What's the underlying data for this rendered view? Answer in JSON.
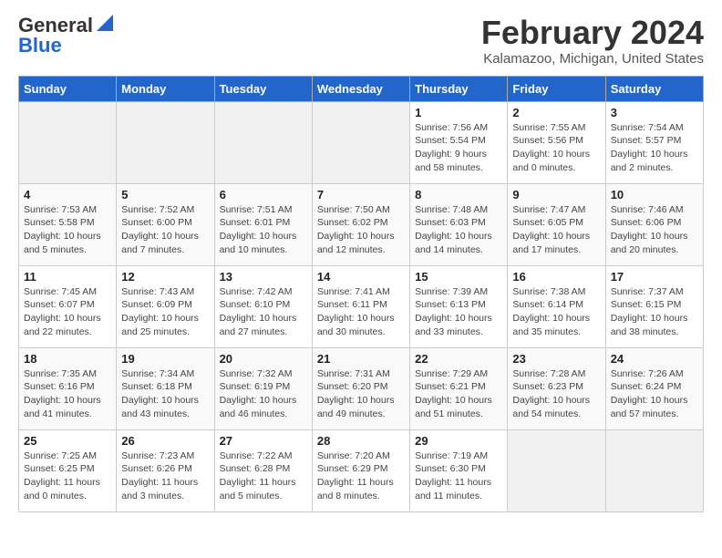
{
  "logo": {
    "general": "General",
    "blue": "Blue"
  },
  "title": {
    "month_year": "February 2024",
    "location": "Kalamazoo, Michigan, United States"
  },
  "headers": [
    "Sunday",
    "Monday",
    "Tuesday",
    "Wednesday",
    "Thursday",
    "Friday",
    "Saturday"
  ],
  "weeks": [
    [
      {
        "day": "",
        "info": ""
      },
      {
        "day": "",
        "info": ""
      },
      {
        "day": "",
        "info": ""
      },
      {
        "day": "",
        "info": ""
      },
      {
        "day": "1",
        "info": "Sunrise: 7:56 AM\nSunset: 5:54 PM\nDaylight: 9 hours\nand 58 minutes."
      },
      {
        "day": "2",
        "info": "Sunrise: 7:55 AM\nSunset: 5:56 PM\nDaylight: 10 hours\nand 0 minutes."
      },
      {
        "day": "3",
        "info": "Sunrise: 7:54 AM\nSunset: 5:57 PM\nDaylight: 10 hours\nand 2 minutes."
      }
    ],
    [
      {
        "day": "4",
        "info": "Sunrise: 7:53 AM\nSunset: 5:58 PM\nDaylight: 10 hours\nand 5 minutes."
      },
      {
        "day": "5",
        "info": "Sunrise: 7:52 AM\nSunset: 6:00 PM\nDaylight: 10 hours\nand 7 minutes."
      },
      {
        "day": "6",
        "info": "Sunrise: 7:51 AM\nSunset: 6:01 PM\nDaylight: 10 hours\nand 10 minutes."
      },
      {
        "day": "7",
        "info": "Sunrise: 7:50 AM\nSunset: 6:02 PM\nDaylight: 10 hours\nand 12 minutes."
      },
      {
        "day": "8",
        "info": "Sunrise: 7:48 AM\nSunset: 6:03 PM\nDaylight: 10 hours\nand 14 minutes."
      },
      {
        "day": "9",
        "info": "Sunrise: 7:47 AM\nSunset: 6:05 PM\nDaylight: 10 hours\nand 17 minutes."
      },
      {
        "day": "10",
        "info": "Sunrise: 7:46 AM\nSunset: 6:06 PM\nDaylight: 10 hours\nand 20 minutes."
      }
    ],
    [
      {
        "day": "11",
        "info": "Sunrise: 7:45 AM\nSunset: 6:07 PM\nDaylight: 10 hours\nand 22 minutes."
      },
      {
        "day": "12",
        "info": "Sunrise: 7:43 AM\nSunset: 6:09 PM\nDaylight: 10 hours\nand 25 minutes."
      },
      {
        "day": "13",
        "info": "Sunrise: 7:42 AM\nSunset: 6:10 PM\nDaylight: 10 hours\nand 27 minutes."
      },
      {
        "day": "14",
        "info": "Sunrise: 7:41 AM\nSunset: 6:11 PM\nDaylight: 10 hours\nand 30 minutes."
      },
      {
        "day": "15",
        "info": "Sunrise: 7:39 AM\nSunset: 6:13 PM\nDaylight: 10 hours\nand 33 minutes."
      },
      {
        "day": "16",
        "info": "Sunrise: 7:38 AM\nSunset: 6:14 PM\nDaylight: 10 hours\nand 35 minutes."
      },
      {
        "day": "17",
        "info": "Sunrise: 7:37 AM\nSunset: 6:15 PM\nDaylight: 10 hours\nand 38 minutes."
      }
    ],
    [
      {
        "day": "18",
        "info": "Sunrise: 7:35 AM\nSunset: 6:16 PM\nDaylight: 10 hours\nand 41 minutes."
      },
      {
        "day": "19",
        "info": "Sunrise: 7:34 AM\nSunset: 6:18 PM\nDaylight: 10 hours\nand 43 minutes."
      },
      {
        "day": "20",
        "info": "Sunrise: 7:32 AM\nSunset: 6:19 PM\nDaylight: 10 hours\nand 46 minutes."
      },
      {
        "day": "21",
        "info": "Sunrise: 7:31 AM\nSunset: 6:20 PM\nDaylight: 10 hours\nand 49 minutes."
      },
      {
        "day": "22",
        "info": "Sunrise: 7:29 AM\nSunset: 6:21 PM\nDaylight: 10 hours\nand 51 minutes."
      },
      {
        "day": "23",
        "info": "Sunrise: 7:28 AM\nSunset: 6:23 PM\nDaylight: 10 hours\nand 54 minutes."
      },
      {
        "day": "24",
        "info": "Sunrise: 7:26 AM\nSunset: 6:24 PM\nDaylight: 10 hours\nand 57 minutes."
      }
    ],
    [
      {
        "day": "25",
        "info": "Sunrise: 7:25 AM\nSunset: 6:25 PM\nDaylight: 11 hours\nand 0 minutes."
      },
      {
        "day": "26",
        "info": "Sunrise: 7:23 AM\nSunset: 6:26 PM\nDaylight: 11 hours\nand 3 minutes."
      },
      {
        "day": "27",
        "info": "Sunrise: 7:22 AM\nSunset: 6:28 PM\nDaylight: 11 hours\nand 5 minutes."
      },
      {
        "day": "28",
        "info": "Sunrise: 7:20 AM\nSunset: 6:29 PM\nDaylight: 11 hours\nand 8 minutes."
      },
      {
        "day": "29",
        "info": "Sunrise: 7:19 AM\nSunset: 6:30 PM\nDaylight: 11 hours\nand 11 minutes."
      },
      {
        "day": "",
        "info": ""
      },
      {
        "day": "",
        "info": ""
      }
    ]
  ]
}
